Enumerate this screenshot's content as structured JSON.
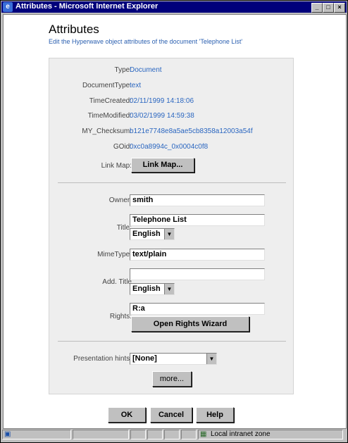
{
  "window": {
    "title": "Attributes - Microsoft Internet Explorer",
    "minimize": "_",
    "maximize": "□",
    "close": "×"
  },
  "header": {
    "title": "Attributes",
    "subtitle": "Edit the Hyperwave object attributes of the document 'Telephone List'"
  },
  "info": [
    {
      "label": "Type:",
      "value": "Document"
    },
    {
      "label": "DocumentType:",
      "value": "text"
    },
    {
      "label": "TimeCreated:",
      "value": "02/11/1999 14:18:06"
    },
    {
      "label": "TimeModified:",
      "value": "03/02/1999 14:59:38"
    },
    {
      "label": "MY_Checksum:",
      "value": "b121e7748e8a5ae5cb8358a12003a54f"
    },
    {
      "label": "GOid:",
      "value": "0xc0a8994c_0x0004c0f8"
    }
  ],
  "linkmap": {
    "label": "Link Map:",
    "button": "Link Map..."
  },
  "form": {
    "owner_label": "Owner:",
    "owner_value": "smith",
    "title_label": "Title:",
    "title_value": "Telephone List",
    "title_lang": "English",
    "mimetype_label": "MimeType:",
    "mimetype_value": "text/plain",
    "addtitle_label": "Add. Title",
    "addtitle_value": "",
    "addtitle_lang": "English",
    "rights_label": "Rights:",
    "rights_value": "R:a",
    "rights_button": "Open Rights Wizard",
    "presentation_label": "Presentation hints:",
    "presentation_value": "[None]",
    "more_button": "more..."
  },
  "buttons": {
    "ok": "OK",
    "cancel": "Cancel",
    "help": "Help"
  },
  "status": {
    "zone": "Local intranet zone"
  }
}
